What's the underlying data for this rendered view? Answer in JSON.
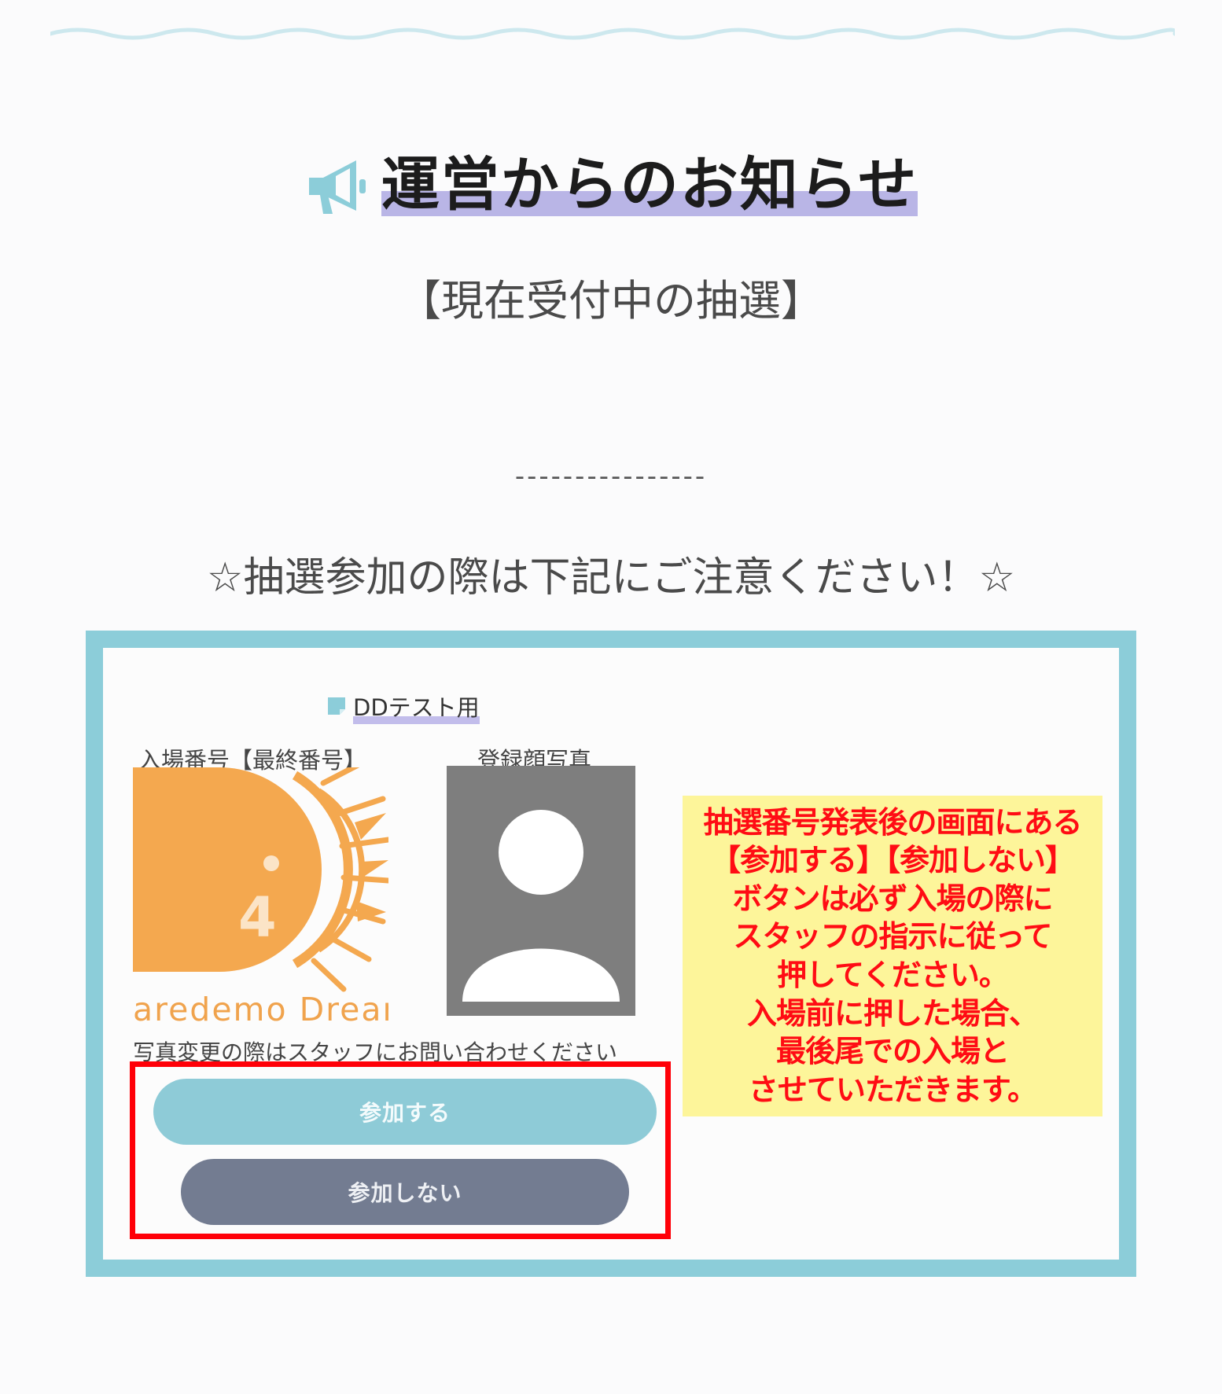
{
  "header": {
    "title": "運営からのお知らせ",
    "icon": "megaphone-icon",
    "accent_color": "#b9b5e6",
    "icon_color": "#8ccdd9"
  },
  "content": {
    "current_lottery": "【現在受付中の抽選】",
    "dashes": "----------------",
    "notice": "☆抽選参加の際は下記にご注意ください！☆"
  },
  "example": {
    "event_title": "DDテスト用",
    "entry_label": "入場番号【最終番号】",
    "photo_label": "登録顔写真",
    "logo_number": "4",
    "logo_text": "aredemo Drean",
    "photo_note": "写真変更の際はスタッフにお問い合わせください",
    "join_button": "参加する",
    "decline_button": "参加しない",
    "warning": "抽選番号発表後の画面にある\n【参加する】【参加しない】\nボタンは必ず入場の際に\nスタッフの指示に従って\n押してください。\n入場前に押した場合、\n最後尾での入場と\nさせていただきます。",
    "frame_color": "#8ccdd9",
    "highlight_box_color": "#ff0008",
    "warning_bg_color": "#fdf59a",
    "warning_text_color": "#ff0c14"
  }
}
